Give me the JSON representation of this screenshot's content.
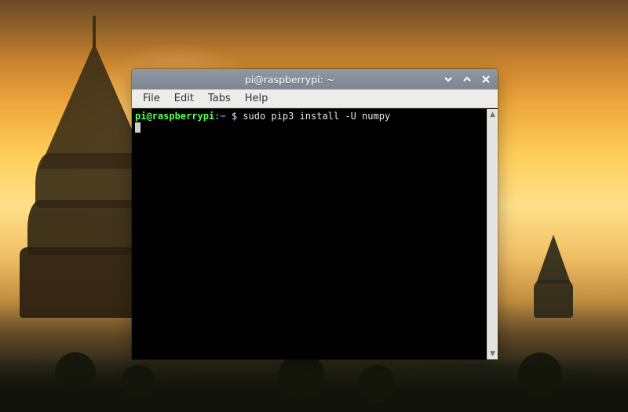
{
  "window": {
    "title": "pi@raspberrypi: ~",
    "menu": {
      "file": "File",
      "edit": "Edit",
      "tabs": "Tabs",
      "help": "Help"
    }
  },
  "terminal": {
    "prompt_user_host": "pi@raspberrypi",
    "prompt_separator": ":",
    "prompt_path": "~",
    "prompt_symbol": " $ ",
    "command": "sudo pip3 install -U numpy"
  }
}
